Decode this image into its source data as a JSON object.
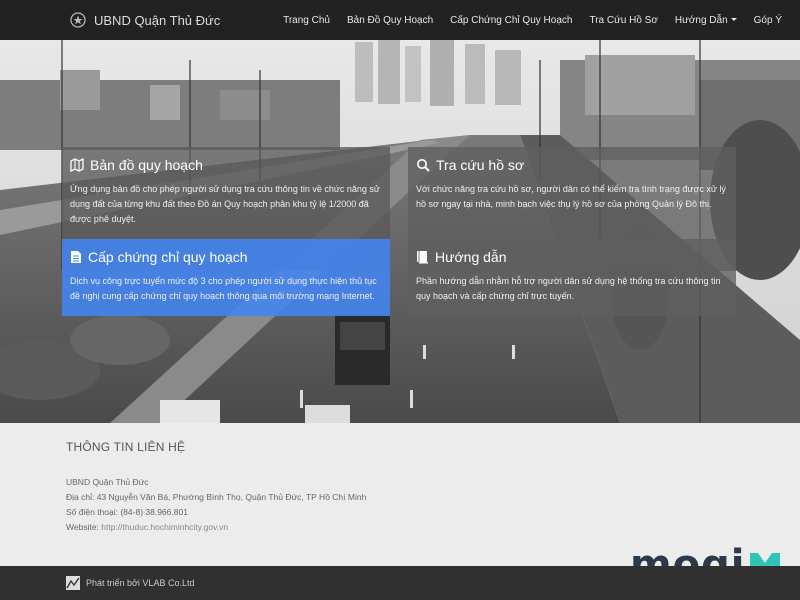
{
  "brand": {
    "title": "UBND Quận Thủ Đức",
    "logo_icon": "emblem-icon"
  },
  "nav": {
    "home": "Trang Chủ",
    "map": "Bản Đồ Quy Hoạch",
    "cert": "Cấp Chứng Chỉ Quy Hoạch",
    "search": "Tra Cứu Hồ Sơ",
    "guide": "Hướng Dẫn",
    "feedback": "Góp Ý"
  },
  "cards": {
    "map": {
      "title": "Bản đồ quy hoạch",
      "icon": "map-icon",
      "text": "Ứng dụng bản đồ cho phép người sử dụng tra cứu thông tin về chức năng sử dụng đất của từng khu đất theo Đồ án Quy hoạch phân khu tỷ lệ 1/2000 đã được phê duyệt."
    },
    "search": {
      "title": "Tra cứu hồ sơ",
      "icon": "search-icon",
      "text": "Với chức năng tra cứu hồ sơ, người dân có thể kiểm tra tình trạng được xử lý hồ sơ ngay tại nhà, minh bạch việc thụ lý hồ sơ của phòng Quản lý Đô thị."
    },
    "cert": {
      "title": "Cấp chứng chỉ quy hoạch",
      "icon": "document-icon",
      "text": "Dịch vụ công trực tuyến mức độ 3 cho phép người sử dụng thực hiện thủ tục đề nghị cung cấp chứng chỉ quy hoạch thông qua môi trường mạng Internet."
    },
    "guide": {
      "title": "Hướng dẫn",
      "icon": "book-icon",
      "text": "Phần hướng dẫn nhằm hỗ trợ người dân sử dụng hệ thống tra cứu thông tin quy hoạch và cấp chứng chỉ trực tuyến."
    }
  },
  "contact": {
    "heading": "THÔNG TIN LIÊN HỆ",
    "org": "UBND Quận Thủ Đức",
    "address": "Địa chỉ: 43 Nguyễn Văn Bá, Phường Bình Thọ, Quận Thủ Đức, TP Hồ Chí Minh",
    "phone": "Số điện thoại: (84-8) 38.966.801",
    "website_label": "Website: ",
    "website_url": "http://thuduc.hochiminhcity.gov.vn"
  },
  "footer": {
    "text": "Phát triển bởi VLAB Co.Ltd"
  },
  "watermark": {
    "text": "mogi"
  },
  "colors": {
    "navbar": "#222222",
    "accent_card": "#4285f4",
    "footer": "#303030",
    "mogi_teal": "#2ec4b6"
  }
}
